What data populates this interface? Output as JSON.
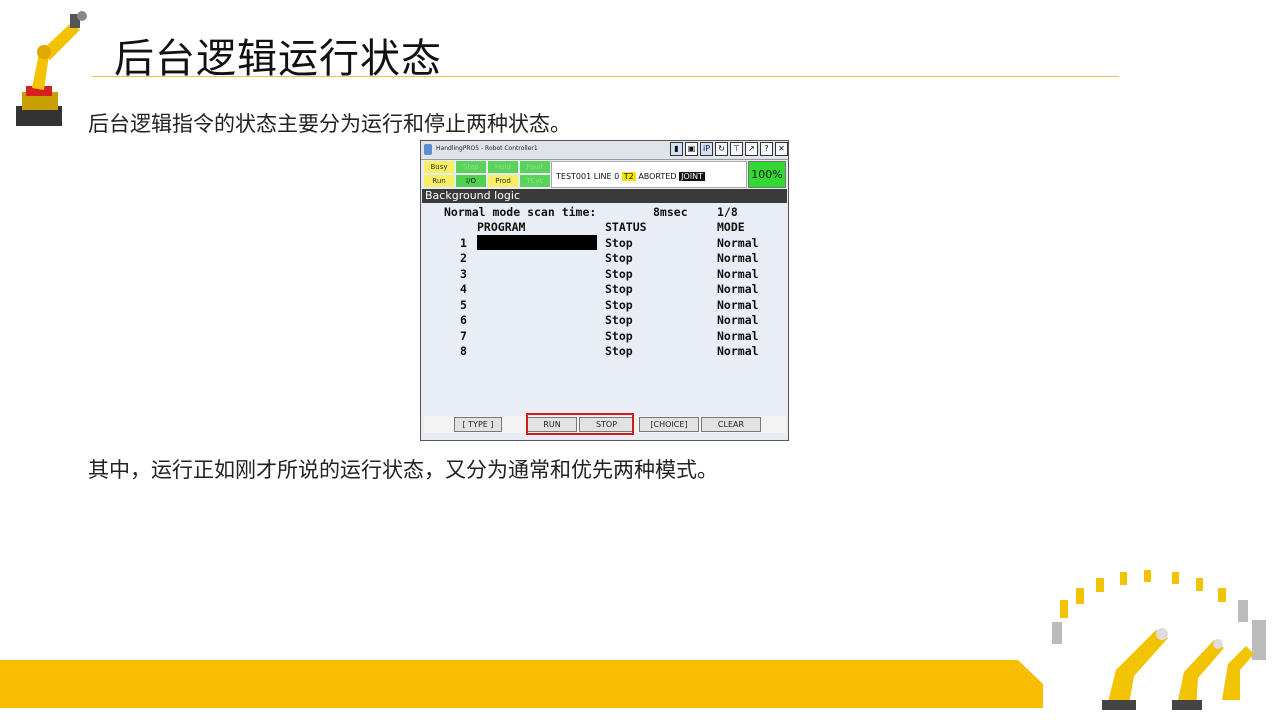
{
  "slide": {
    "title": "后台逻辑运行状态",
    "para1": "后台逻辑指令的状态主要分为运行和停止两种状态。",
    "para2": "其中，运行正如刚才所说的运行状态，又分为通常和优先两种模式。",
    "accent_color": "#f9bd00"
  },
  "pendant": {
    "window_title": "HandlingPRO5 - Robot Controller1",
    "toolbar_icons": [
      "trash-icon",
      "keyboard-icon",
      "ip-icon",
      "refresh-icon",
      "tree-icon",
      "arm-icon",
      "help-icon",
      "close-icon"
    ],
    "toolbar_labels": {
      "ip": "iP",
      "help": "?",
      "close": "✕"
    },
    "leds": [
      {
        "label": "Busy",
        "color": "yellow"
      },
      {
        "label": "Step",
        "color": "green"
      },
      {
        "label": "Hold",
        "color": "green"
      },
      {
        "label": "Fault",
        "color": "green"
      },
      {
        "label": "Run",
        "color": "yellow"
      },
      {
        "label": "I/O",
        "color": "green"
      },
      {
        "label": "Prod",
        "color": "yellow"
      },
      {
        "label": "TCyc",
        "color": "green"
      }
    ],
    "status": {
      "program": "TEST001",
      "line": "LINE 0",
      "mode_badge": "T2",
      "state": "ABORTED",
      "coord": "JOINT"
    },
    "override": "100%",
    "screen_title": "Background logic",
    "scan_label": "Normal mode scan time:",
    "scan_value": "8msec",
    "page": "1/8",
    "headers": {
      "program": "PROGRAM",
      "status": "STATUS",
      "mode": "MODE"
    },
    "rows": [
      {
        "num": "1",
        "program": "",
        "status": "Stop",
        "mode": "Normal"
      },
      {
        "num": "2",
        "program": "",
        "status": "Stop",
        "mode": "Normal"
      },
      {
        "num": "3",
        "program": "",
        "status": "Stop",
        "mode": "Normal"
      },
      {
        "num": "4",
        "program": "",
        "status": "Stop",
        "mode": "Normal"
      },
      {
        "num": "5",
        "program": "",
        "status": "Stop",
        "mode": "Normal"
      },
      {
        "num": "6",
        "program": "",
        "status": "Stop",
        "mode": "Normal"
      },
      {
        "num": "7",
        "program": "",
        "status": "Stop",
        "mode": "Normal"
      },
      {
        "num": "8",
        "program": "",
        "status": "Stop",
        "mode": "Normal"
      }
    ],
    "softkeys": {
      "type": "[ TYPE ]",
      "run": "RUN",
      "stop": "STOP",
      "choice": "[CHOICE]",
      "clear": "CLEAR"
    },
    "highlight_color": "#d01d1d"
  }
}
